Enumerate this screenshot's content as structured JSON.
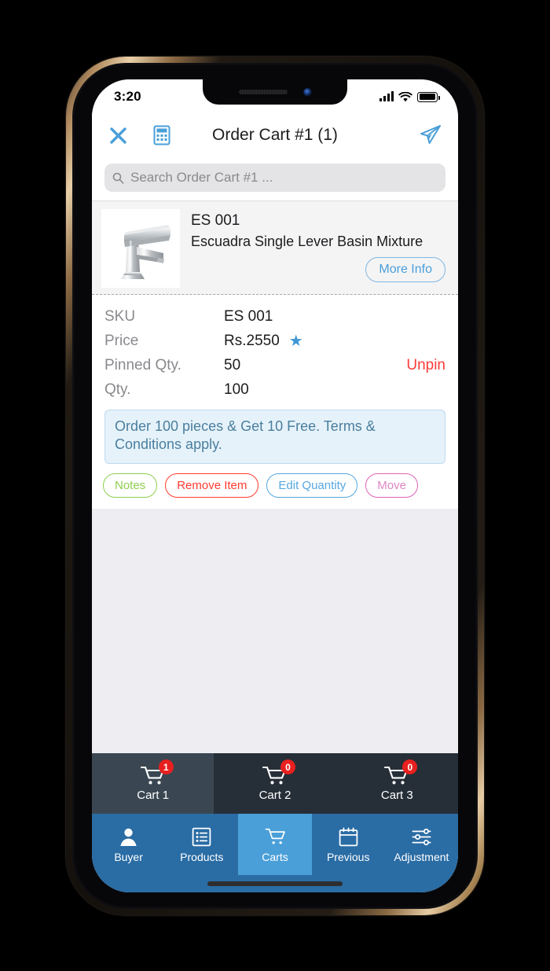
{
  "device": {
    "status_bar": {
      "time": "3:20",
      "signal_icon": "signal-bars-icon",
      "wifi_icon": "wifi-icon",
      "battery_icon": "battery-full-icon"
    },
    "notch": {
      "speaker_icon": "speaker-grille-icon",
      "camera_icon": "front-camera-icon"
    },
    "home_indicator": "home-indicator"
  },
  "header": {
    "close_icon": "close-icon",
    "calculator_icon": "calculator-icon",
    "title": "Order Cart #1 (1)",
    "send_icon": "send-paper-plane-icon",
    "accent_color": "#4a9fd8"
  },
  "search": {
    "icon": "search-icon",
    "placeholder": "Search Order Cart #1 ...",
    "value": ""
  },
  "item": {
    "thumbnail_icon": "product-image-basin-mixer",
    "sku_title": "ES 001",
    "name": "Escuadra Single Lever Basin Mixture",
    "more_info_label": "More Info",
    "details": [
      {
        "label": "SKU",
        "value": "ES 001"
      },
      {
        "label": "Price",
        "value": "Rs.2550"
      },
      {
        "label": "Pinned Qty.",
        "value": "50"
      },
      {
        "label": "Qty.",
        "value": "100"
      }
    ],
    "price_star_icon": "star-icon",
    "unpin_label": "Unpin",
    "unpin_color": "#fc3d39",
    "promo_text": "Order 100 pieces & Get 10 Free. Terms & Conditions apply.",
    "actions": [
      {
        "label": "Notes",
        "color": "#8fce4f"
      },
      {
        "label": "Remove Item",
        "color": "#ff3b30"
      },
      {
        "label": "Edit Quantity",
        "color": "#56a7e0"
      },
      {
        "label": "Move",
        "color": "#dd86c4"
      }
    ]
  },
  "cart_tabs": [
    {
      "label": "Cart 1",
      "badge": "1",
      "icon": "shopping-cart-icon",
      "active": true
    },
    {
      "label": "Cart 2",
      "badge": "0",
      "icon": "shopping-cart-icon",
      "active": false
    },
    {
      "label": "Cart 3",
      "badge": "0",
      "icon": "shopping-cart-icon",
      "active": false
    }
  ],
  "bottom_nav": [
    {
      "label": "Buyer",
      "icon": "person-icon",
      "active": false
    },
    {
      "label": "Products",
      "icon": "list-icon",
      "active": false
    },
    {
      "label": "Carts",
      "icon": "shopping-cart-icon",
      "active": true
    },
    {
      "label": "Previous",
      "icon": "calendar-icon",
      "active": false
    },
    {
      "label": "Adjustment",
      "icon": "sliders-icon",
      "active": false
    }
  ],
  "colors": {
    "brand_blue": "#2a6ca4",
    "active_blue": "#4a9fd8",
    "tab_bar_dark": "#262f38",
    "tab_active_dark": "#3a4752",
    "badge_red": "#e8201f",
    "list_bg": "#eeeef2",
    "promo_bg": "#e6f2fa"
  }
}
